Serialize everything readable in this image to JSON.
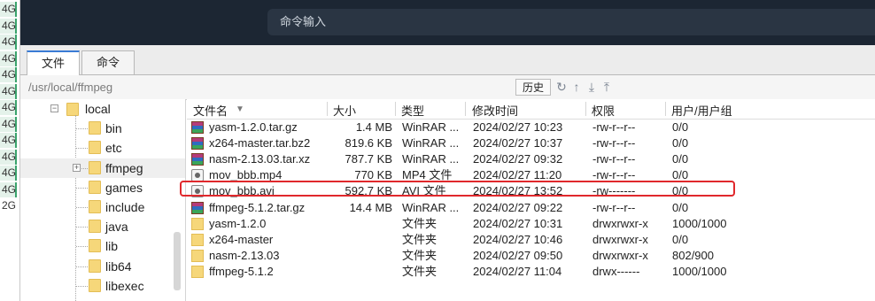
{
  "left_strip": [
    "4G",
    "4G",
    "4G",
    "4G",
    "4G",
    "4G",
    "4G",
    "4G",
    "4G",
    "4G",
    "4G",
    "4G",
    "2G"
  ],
  "header": {
    "command_input_placeholder": "命令输入"
  },
  "tabs": [
    {
      "label": "文件",
      "active": true
    },
    {
      "label": "命令",
      "active": false
    }
  ],
  "pathbar": {
    "path": "/usr/local/ffmpeg",
    "history_label": "历史",
    "tools": [
      "refresh-icon",
      "up-icon",
      "download-icon",
      "upload-icon"
    ]
  },
  "tree": {
    "root": "local",
    "items": [
      "bin",
      "etc",
      "ffmpeg",
      "games",
      "include",
      "java",
      "lib",
      "lib64",
      "libexec"
    ],
    "selected": "ffmpeg"
  },
  "file_list": {
    "columns": [
      "文件名",
      "大小",
      "类型",
      "修改时间",
      "权限",
      "用户/用户组"
    ],
    "rows": [
      {
        "icon": "rar-icon",
        "name": "yasm-1.2.0.tar.gz",
        "size": "1.4 MB",
        "type": "WinRAR ...",
        "time": "2024/02/27 10:23",
        "perm": "-rw-r--r--",
        "owner": "0/0"
      },
      {
        "icon": "rar-icon",
        "name": "x264-master.tar.bz2",
        "size": "819.6 KB",
        "type": "WinRAR ...",
        "time": "2024/02/27 10:37",
        "perm": "-rw-r--r--",
        "owner": "0/0"
      },
      {
        "icon": "rar-icon",
        "name": "nasm-2.13.03.tar.xz",
        "size": "787.7 KB",
        "type": "WinRAR ...",
        "time": "2024/02/27 09:32",
        "perm": "-rw-r--r--",
        "owner": "0/0"
      },
      {
        "icon": "video-file-icon",
        "name": "mov_bbb.mp4",
        "size": "770 KB",
        "type": "MP4 文件",
        "time": "2024/02/27 11:20",
        "perm": "-rw-r--r--",
        "owner": "0/0"
      },
      {
        "icon": "video-file-icon",
        "name": "mov_bbb.avi",
        "size": "592.7 KB",
        "type": "AVI 文件",
        "time": "2024/02/27 13:52",
        "perm": "-rw-------",
        "owner": "0/0"
      },
      {
        "icon": "rar-icon",
        "name": "ffmpeg-5.1.2.tar.gz",
        "size": "14.4 MB",
        "type": "WinRAR ...",
        "time": "2024/02/27 09:22",
        "perm": "-rw-r--r--",
        "owner": "0/0"
      },
      {
        "icon": "folder-icon",
        "name": "yasm-1.2.0",
        "size": "",
        "type": "文件夹",
        "time": "2024/02/27 10:31",
        "perm": "drwxrwxr-x",
        "owner": "1000/1000"
      },
      {
        "icon": "folder-icon",
        "name": "x264-master",
        "size": "",
        "type": "文件夹",
        "time": "2024/02/27 10:46",
        "perm": "drwxrwxr-x",
        "owner": "0/0"
      },
      {
        "icon": "folder-icon",
        "name": "nasm-2.13.03",
        "size": "",
        "type": "文件夹",
        "time": "2024/02/27 09:50",
        "perm": "drwxrwxr-x",
        "owner": "802/900"
      },
      {
        "icon": "folder-icon",
        "name": "ffmpeg-5.1.2",
        "size": "",
        "type": "文件夹",
        "time": "2024/02/27 11:04",
        "perm": "drwx------",
        "owner": "1000/1000"
      }
    ],
    "highlighted_row": "mov_bbb.avi",
    "highlight_color": "#e0282c"
  },
  "colors": {
    "header_bg": "#1c2633",
    "active_tab_accent": "#3a7bd5",
    "strip_accent": "#3aa36c"
  }
}
